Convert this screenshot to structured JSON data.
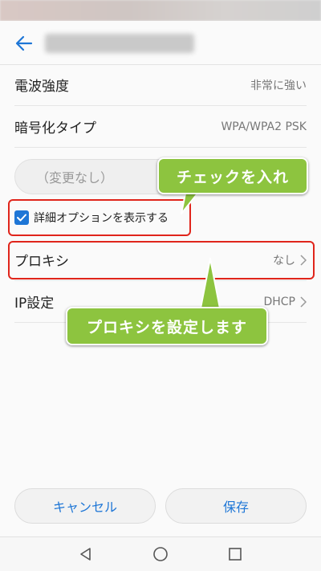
{
  "header": {
    "back_icon": "arrow-left-icon"
  },
  "rows": {
    "signal": {
      "label": "電波強度",
      "value": "非常に強い"
    },
    "security": {
      "label": "暗号化タイプ",
      "value": "WPA/WPA2 PSK"
    },
    "proxy": {
      "label": "プロキシ",
      "value": "なし"
    },
    "ip": {
      "label": "IP設定",
      "value": "DHCP"
    }
  },
  "password": {
    "placeholder": "（変更なし）"
  },
  "advanced": {
    "label": "詳細オプションを表示する",
    "checked": true
  },
  "callouts": {
    "check": "チェックを入れ",
    "proxy": "プロキシを設定します"
  },
  "footer": {
    "cancel_label": "キャンセル",
    "save_label": "保存"
  },
  "colors": {
    "accent": "#1e76d6",
    "highlight": "#e0251b",
    "callout": "#8dc43f"
  }
}
